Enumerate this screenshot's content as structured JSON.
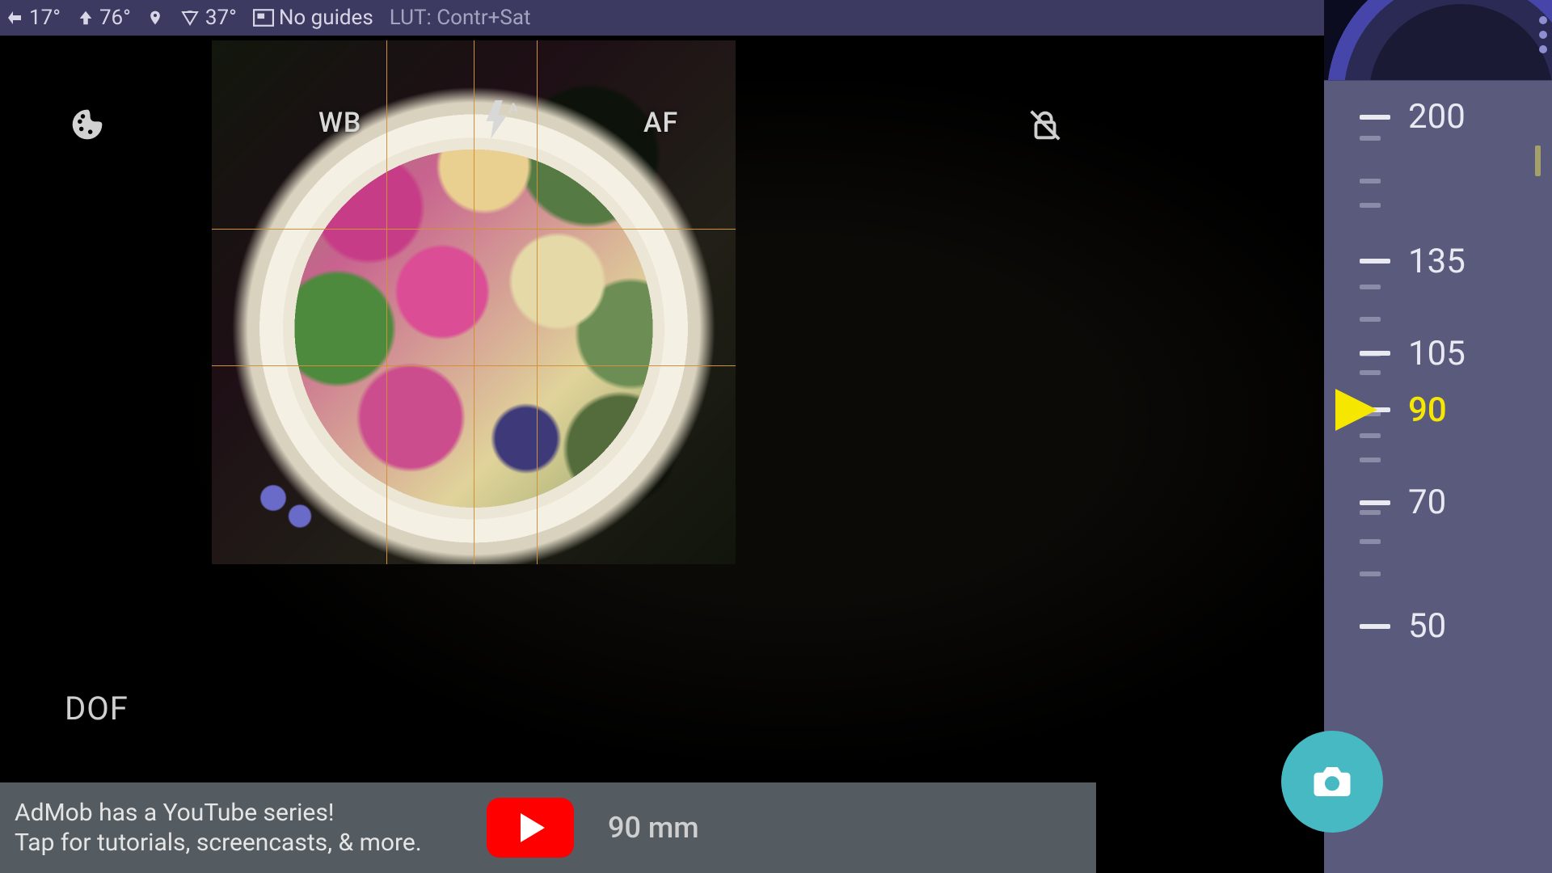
{
  "topbar": {
    "tilt_back": "17°",
    "tilt_up": "76°",
    "fov": "37°",
    "guides": "No guides",
    "lut": "LUT: Contr+Sat",
    "format": "6x6"
  },
  "overlay": {
    "wb": "WB",
    "flash": "A",
    "af": "AF",
    "dof": "DOF"
  },
  "focal": {
    "selected": 90,
    "readout": "90 mm",
    "marks": [
      200,
      135,
      105,
      90,
      70,
      50
    ]
  },
  "ad": {
    "line1": "AdMob has a YouTube series!",
    "line2": "Tap for tutorials, screencasts, & more."
  },
  "icons": {
    "palette": "palette-icon",
    "lock": "rotation-lock-icon",
    "camera": "camera-icon",
    "location": "location-pin-icon",
    "flash": "flash-auto-icon",
    "youtube": "youtube-icon"
  }
}
